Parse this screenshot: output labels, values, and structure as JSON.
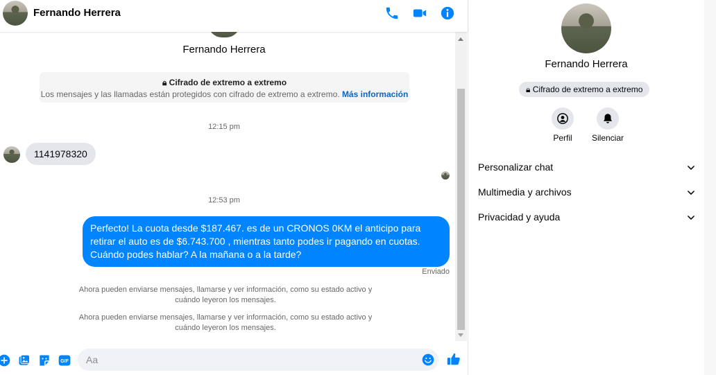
{
  "header": {
    "contact_name": "Fernando Herrera",
    "icons": [
      "phone-icon",
      "video-icon",
      "info-icon"
    ],
    "accent_color": "#0084ff"
  },
  "conversation": {
    "contact_name": "Fernando Herrera",
    "encryption": {
      "title": "Cifrado de extremo a extremo",
      "body": "Los mensajes y las llamadas están protegidos con cifrado de extremo a extremo.",
      "link": "Más información"
    },
    "messages": [
      {
        "time": "12:15 pm",
        "direction": "incoming",
        "text": "1141978320"
      },
      {
        "time": "12:53 pm",
        "direction": "outgoing",
        "text": "Perfecto! La cuota desde $187.467. es de un CRONOS 0KM el anticipo para retirar el auto es de $6.743.700 , mientras tanto podes ir pagando en cuotas. Cuándo podes hablar? A la mañana o a la tarde?",
        "status": "Enviado"
      }
    ],
    "system_notices": [
      "Ahora pueden enviarse mensajes, llamarse y ver información, como su estado activo y cuándo leyeron los mensajes.",
      "Ahora pueden enviarse mensajes, llamarse y ver información, como su estado activo y cuándo leyeron los mensajes."
    ]
  },
  "composer": {
    "placeholder": "Aa",
    "icons": [
      "plus-icon",
      "image-icon",
      "sticker-icon",
      "gif-icon",
      "emoji-icon",
      "like-icon"
    ],
    "gif_label": "GIF"
  },
  "profile_panel": {
    "name": "Fernando Herrera",
    "badge": "Cifrado de extremo a extremo",
    "actions": [
      {
        "label": "Perfil",
        "icon": "profile-icon"
      },
      {
        "label": "Silenciar",
        "icon": "bell-icon"
      }
    ],
    "sections": [
      {
        "label": "Personalizar chat"
      },
      {
        "label": "Multimedia y archivos"
      },
      {
        "label": "Privacidad y ayuda"
      }
    ]
  }
}
